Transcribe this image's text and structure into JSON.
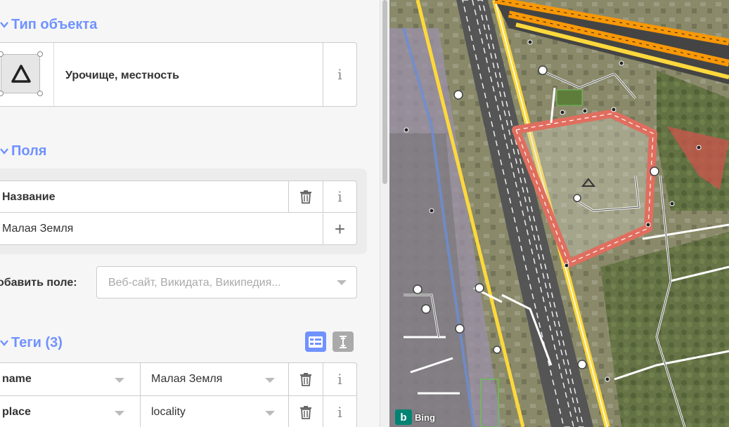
{
  "sections": {
    "preset": {
      "title": "Тип объекта",
      "name": "Урочище, местность"
    },
    "fields": {
      "title": "Поля"
    },
    "tags": {
      "title": "Теги (3)"
    }
  },
  "field_name": {
    "label": "Название",
    "value": "Малая Земля"
  },
  "add_field": {
    "label": "обавить поле:",
    "placeholder": "Веб-сайт, Викидата, Википедия..."
  },
  "tags": [
    {
      "key": "name",
      "value": "Малая Земля"
    },
    {
      "key": "place",
      "value": "locality"
    }
  ],
  "icons": {
    "info": "i",
    "add": "+",
    "collapse": "chevron-down",
    "delete": "trash",
    "preset": "triangle",
    "list_view": "list-view",
    "text_view": "text-view"
  },
  "colors": {
    "accent": "#7092ff",
    "area_outline": "#e06e5f",
    "road_major": "#f99806",
    "road_trunk": "#fdd83c"
  },
  "map": {
    "attribution": "Bing"
  }
}
